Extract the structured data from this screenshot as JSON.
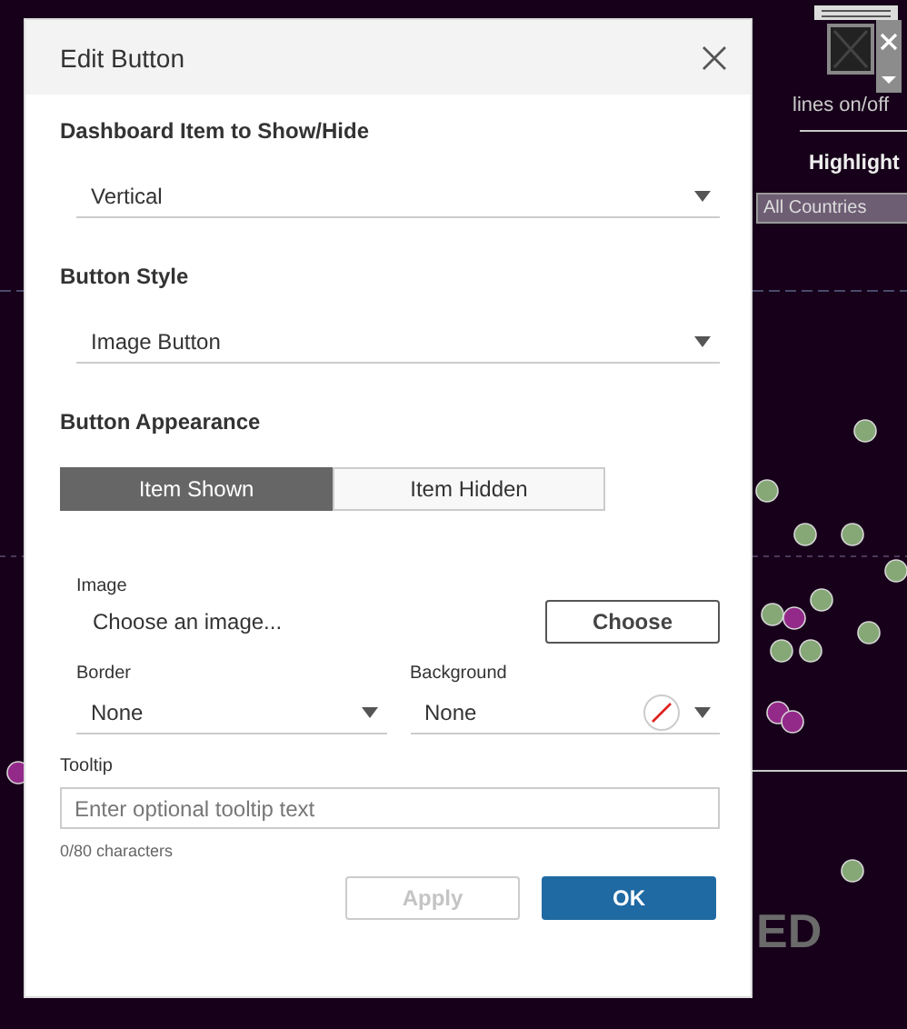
{
  "dashboard": {
    "legend_label": "lines on/off",
    "highlight_label": "Highlight",
    "highlight_value": "All Countries",
    "quadrant_label": "ED"
  },
  "dialog": {
    "title": "Edit Button",
    "dashboard_item": {
      "label": "Dashboard Item to Show/Hide",
      "value": "Vertical"
    },
    "button_style": {
      "label": "Button Style",
      "value": "Image Button"
    },
    "appearance": {
      "label": "Button Appearance",
      "tabs": [
        {
          "label": "Item Shown",
          "selected": true
        },
        {
          "label": "Item Hidden",
          "selected": false
        }
      ]
    },
    "image": {
      "label": "Image",
      "value": "Choose an image...",
      "button": "Choose"
    },
    "border": {
      "label": "Border",
      "value": "None"
    },
    "background": {
      "label": "Background",
      "value": "None"
    },
    "tooltip": {
      "label": "Tooltip",
      "placeholder": "Enter optional tooltip text",
      "count": "0/80 characters"
    },
    "buttons": [
      {
        "label": "Apply",
        "disabled": true
      },
      {
        "label": "OK",
        "disabled": false
      }
    ]
  }
}
